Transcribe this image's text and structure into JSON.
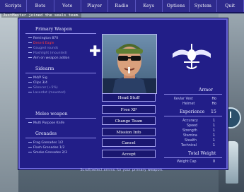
{
  "menu": [
    "Scripts",
    "Bots",
    "Vote",
    "Player",
    "Radio",
    "Keys",
    "Options",
    "System",
    "Quit"
  ],
  "chat_line": "JustMaster joined the seals team.",
  "hint": "Scroll/select ammo for your primary weapon.",
  "primary": {
    "title": "Primary Weapon",
    "items": [
      "Remington 870",
      "Desert Eagle",
      "Gauged rounds",
      "Flashlight (mounted)",
      "Aim on weapon addon"
    ],
    "selected_index": 1
  },
  "sidearm": {
    "title": "Sidearm",
    "items": [
      "M4/P Sig",
      "Clips   3/4",
      "Silencer  (+5%)",
      "Laserdot (mounted)"
    ]
  },
  "melee": {
    "title": "Melee weapon",
    "items": [
      "Multi Purpose Knife"
    ]
  },
  "grenades": {
    "title": "Grenades",
    "items": [
      "Frag Grenades   1/2",
      "Flash Grenades   1/2",
      "Smoke Grenades   2/3"
    ]
  },
  "buttons": [
    "Head Stuff",
    "Free XP",
    "Change Team",
    "Mission Info",
    "Cancel",
    "Accept"
  ],
  "armor": {
    "title": "Armor",
    "rows": [
      {
        "label": "Kevlar Vest",
        "value": "Ho"
      },
      {
        "label": "Helmet",
        "value": "Ho"
      }
    ]
  },
  "experience": {
    "label": "Experience",
    "value": "15"
  },
  "skills": [
    {
      "label": "Accuracy",
      "value": "1"
    },
    {
      "label": "Speed",
      "value": "1"
    },
    {
      "label": "Strength",
      "value": "1"
    },
    {
      "label": "Stamina",
      "value": "1"
    },
    {
      "label": "Stealth",
      "value": "1"
    },
    {
      "label": "Technical",
      "value": "1"
    }
  ],
  "total_weight": {
    "title": "Total Weight",
    "label": "Weight Cap",
    "value": "0"
  },
  "colors": {
    "panel": "#221e88",
    "menubar": "#2e2a8c",
    "selected": "#ff3a3a"
  }
}
